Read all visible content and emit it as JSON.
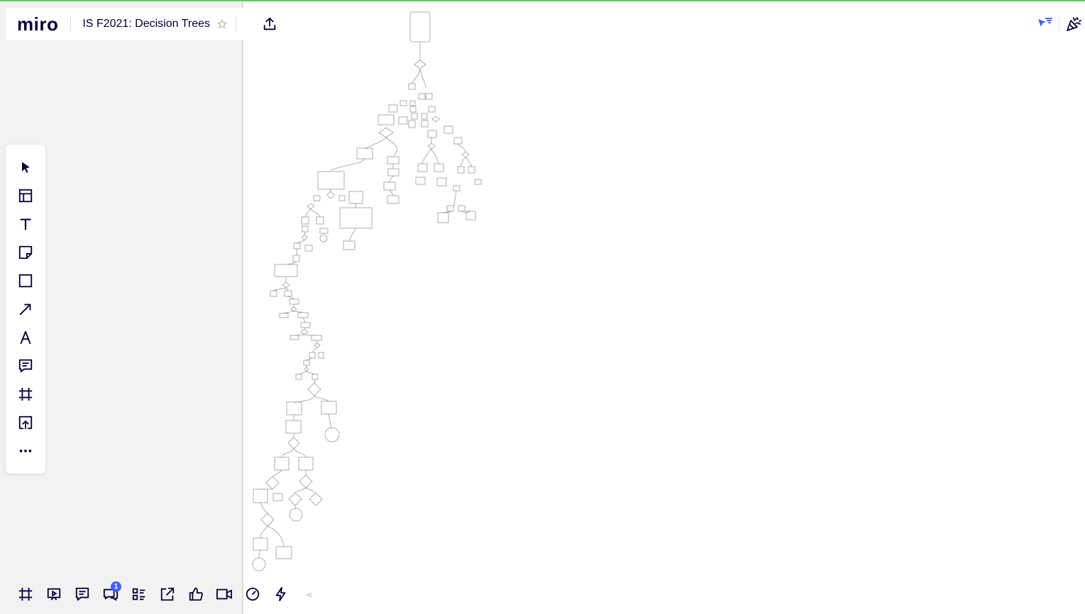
{
  "app": {
    "logo": "miro"
  },
  "board": {
    "title": "IS F2021: Decision Trees"
  },
  "colors": {
    "accent": "#4262ff",
    "top_bar_accent": "#5ecb5a",
    "ink": "#050038"
  },
  "header": {
    "star_icon": "star-icon",
    "share_icon": "upload-icon",
    "right_icons": [
      "cursor-filter-icon",
      "celebration-icon"
    ]
  },
  "toolbar": {
    "tools": [
      "select-icon",
      "templates-icon",
      "text-icon",
      "sticky-note-icon",
      "shape-icon",
      "arrow-icon",
      "pen-icon",
      "comment-icon",
      "frame-icon",
      "upload-icon",
      "more-icon"
    ]
  },
  "bottom_bar": {
    "items": [
      "frames-icon",
      "presentation-icon",
      "notes-icon",
      "chat-icon",
      "card-list-icon",
      "share-screen-icon",
      "vote-icon",
      "video-icon",
      "timer-icon",
      "activity-icon"
    ],
    "chat_badge": "1",
    "collapse_label": "«"
  },
  "canvas": {
    "content": "decision-tree-diagram"
  }
}
